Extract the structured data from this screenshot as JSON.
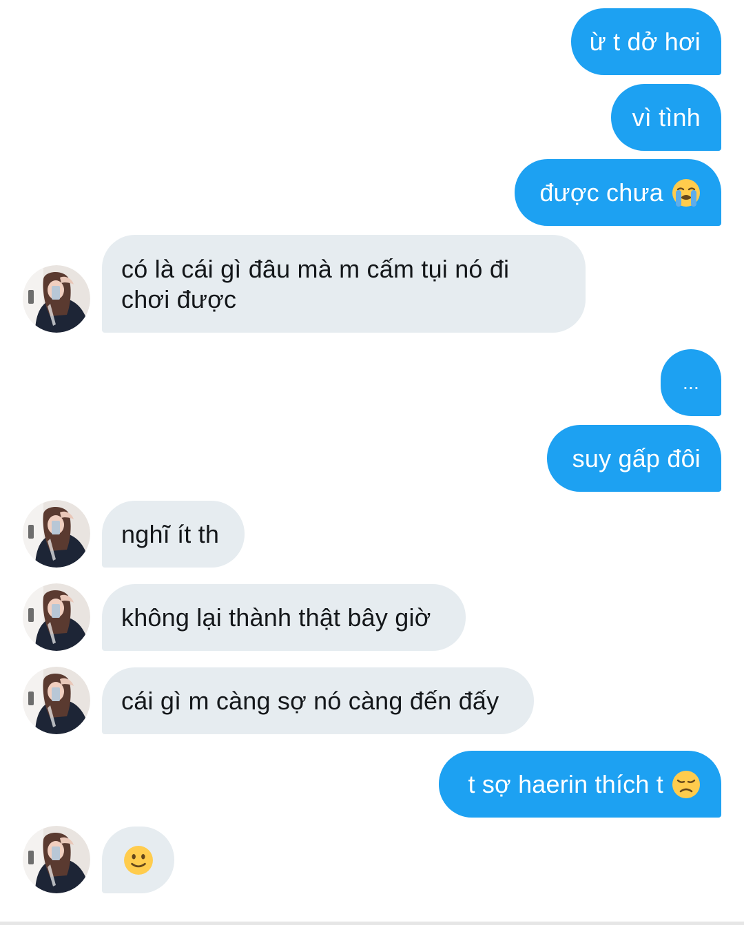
{
  "messages": [
    {
      "id": "m1",
      "side": "out",
      "text": "ừ t dở hơi"
    },
    {
      "id": "m2",
      "side": "out",
      "text": "vì tình"
    },
    {
      "id": "m3",
      "side": "out",
      "text": "được chưa",
      "emoji": "loudly-crying-face-icon"
    },
    {
      "id": "m4",
      "side": "in",
      "text": "có là cái gì đâu mà m cấm tụi nó đi chơi được"
    },
    {
      "id": "m5",
      "side": "out",
      "text": "..."
    },
    {
      "id": "m6",
      "side": "out",
      "text": "suy gấp đôi"
    },
    {
      "id": "m7",
      "side": "in",
      "text": "nghĩ ít th"
    },
    {
      "id": "m8",
      "side": "in",
      "text": "không lại thành thật bây giờ"
    },
    {
      "id": "m9",
      "side": "in",
      "text": "cái gì m càng sợ nó càng đến đấy"
    },
    {
      "id": "m10",
      "side": "out",
      "text": "t sợ haerin thích t",
      "emoji": "disappointed-face-icon"
    },
    {
      "id": "m11",
      "side": "in",
      "text": "",
      "emoji": "slightly-smiling-face-icon"
    }
  ],
  "colors": {
    "outgoing_bubble": "#1da1f2",
    "incoming_bubble": "#e6ecf0",
    "outgoing_text": "#ffffff",
    "incoming_text": "#14171a"
  }
}
